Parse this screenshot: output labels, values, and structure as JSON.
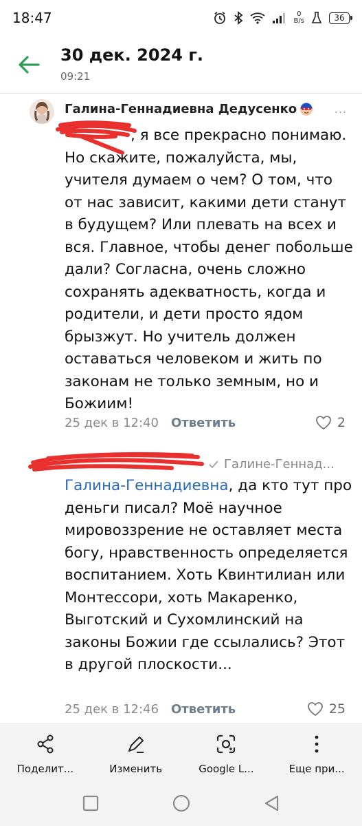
{
  "status_bar": {
    "time": "18:47",
    "net_speed_value": "0",
    "net_speed_unit": "B/s",
    "battery": "36",
    "icons": [
      "alarm-icon",
      "bluetooth-icon",
      "wifi-icon",
      "signal-icon",
      "net-speed",
      "flask-icon",
      "battery-icon"
    ]
  },
  "header": {
    "title": "30 дек. 2024 г.",
    "subtitle": "09:21",
    "back_icon": "arrow-left-icon",
    "accent_color": "#2e9e57"
  },
  "comments": [
    {
      "author": "Галина-Геннадиевна Дедусенко",
      "text": ", я все прекрасно понимаю. Но скажите, пожалуйста, мы, учителя думаем о чем? О том, что от нас зависит, какими дети станут в будущем? Или плевать на всех и вся. Главное, чтобы денег побольше дали? Согласна, очень сложно сохранять адекватность, когда и родители, и дети просто ядом брызжут. Но учитель должен оставаться человеком и жить по законам не только земным, но и Божиим!",
      "date": "25 дек в 12:40",
      "reply_label": "Ответить",
      "likes": "2",
      "more": "..."
    },
    {
      "reply_to": "Галине-Геннад...",
      "mention": "Галина-Геннадиевна",
      "text": ", да кто тут про деньги писал? Моё научное мировоззрение не оставляет места богу, нравственность определяется воспитанием.   Хоть Квинтилиан или Монтессори, хоть Макаренко, Выготский и Сухомлинский  на законы Божии где ссылались? Этот в другой плоскости...",
      "date": "25 дек в 12:46",
      "reply_label": "Ответить",
      "likes": "25"
    }
  ],
  "action_bar": {
    "items": [
      {
        "label": "Поделит...",
        "icon": "share-icon"
      },
      {
        "label": "Изменить",
        "icon": "edit-icon"
      },
      {
        "label": "Google L...",
        "icon": "google-lens-icon"
      },
      {
        "label": "Еще при...",
        "icon": "more-vertical-icon"
      }
    ]
  },
  "nav_bar": {
    "icons": [
      "recent-apps-icon",
      "home-icon",
      "back-icon"
    ]
  },
  "colors": {
    "mention": "#2a6bb5",
    "redaction_scribble": "#e8302e",
    "bar_background": "#f3f3f3"
  }
}
